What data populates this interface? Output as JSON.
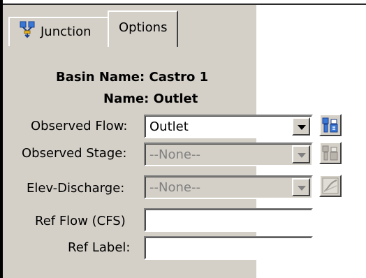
{
  "tabs": [
    {
      "label": "Junction",
      "icon": "junction-icon",
      "active": false
    },
    {
      "label": "Options",
      "active": true
    }
  ],
  "info": {
    "basin_label": "Basin Name:",
    "basin_value": "Castro 1",
    "name_label": "Name:",
    "name_value": "Outlet"
  },
  "fields": {
    "observed_flow": {
      "label": "Observed Flow:",
      "value": "Outlet",
      "enabled": true,
      "button_icon": "gage-select-icon"
    },
    "observed_stage": {
      "label": "Observed Stage:",
      "value": "--None--",
      "enabled": false,
      "button_icon": "gage-select-icon"
    },
    "elev_discharge": {
      "label": "Elev-Discharge:",
      "value": "--None--",
      "enabled": false,
      "button_icon": "curve-icon"
    },
    "ref_flow": {
      "label": "Ref Flow (CFS)",
      "value": ""
    },
    "ref_label": {
      "label": "Ref Label:",
      "value": ""
    }
  },
  "colors": {
    "panel": "#d4d0c8",
    "disabled_text": "#808080"
  }
}
